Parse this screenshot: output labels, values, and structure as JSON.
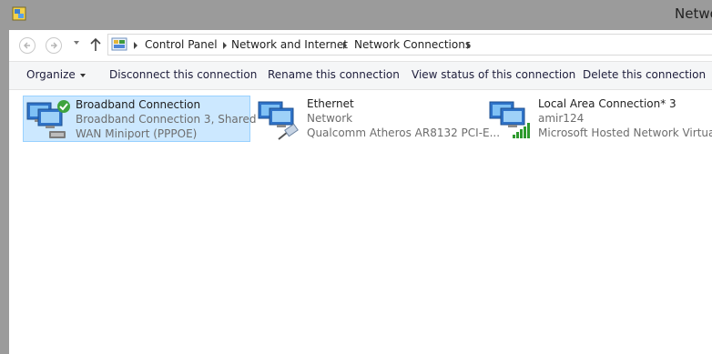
{
  "window": {
    "title": "Netwo"
  },
  "nav": {
    "back_icon": "arrow-left-icon",
    "forward_icon": "arrow-right-icon",
    "up_icon": "arrow-up-icon"
  },
  "breadcrumb": [
    "Control Panel",
    "Network and Internet",
    "Network Connections"
  ],
  "toolbar": {
    "organize_label": "Organize",
    "disconnect_label": "Disconnect this connection",
    "rename_label": "Rename this connection",
    "view_status_label": "View status of this connection",
    "delete_label": "Delete this connection"
  },
  "connections": [
    {
      "name": "Broadband Connection",
      "status": "Broadband Connection  3, Shared",
      "device": "WAN Miniport (PPPOE)",
      "selected": true,
      "icon": "network-connected-icon"
    },
    {
      "name": "Ethernet",
      "status": "Network",
      "device": "Qualcomm Atheros AR8132 PCI-E...",
      "selected": false,
      "icon": "ethernet-icon"
    },
    {
      "name": "Local Area Connection* 3",
      "status": "amir124",
      "device": "Microsoft Hosted Network Virtual...",
      "selected": false,
      "icon": "wifi-signal-icon"
    }
  ],
  "colors": {
    "selection_bg": "#cce8ff",
    "selection_border": "#99d1ff",
    "titlebar": "#9b9b9b"
  }
}
